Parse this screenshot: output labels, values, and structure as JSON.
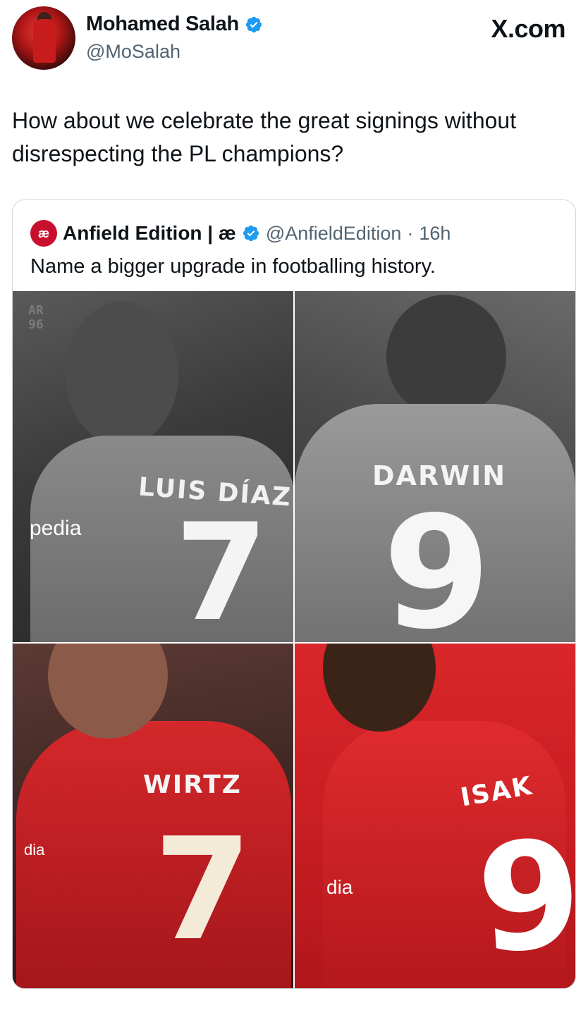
{
  "header": {
    "display_name": "Mohamed Salah",
    "handle": "@MoSalah",
    "site_brand": "X.com"
  },
  "tweet": {
    "text": "How about we celebrate the great signings without disrespecting the PL champions?"
  },
  "quote": {
    "logo_text": "æ",
    "display_name": "Anfield Edition | æ",
    "handle": "@AnfieldEdition",
    "separator": "·",
    "time": "16h",
    "text": "Name a bigger upgrade in footballing history.",
    "watermark": "AR\n96",
    "panels": [
      {
        "jersey_name": "LUIS DÍAZ",
        "jersey_number": "7",
        "sponsor": "pedia"
      },
      {
        "jersey_name": "DARWIN",
        "jersey_number": "9"
      },
      {
        "jersey_name": "WIRTZ",
        "jersey_number": "7",
        "sponsor": "dia"
      },
      {
        "jersey_name": "ISAK",
        "jersey_number": "9",
        "sponsor": "dia"
      }
    ]
  },
  "colors": {
    "verified_blue": "#1d9bf0",
    "text_primary": "#0f1419",
    "text_secondary": "#536471",
    "border": "#cfd9de",
    "liverpool_red": "#c8102e"
  },
  "icons": {
    "verified": "verified-badge-icon"
  }
}
